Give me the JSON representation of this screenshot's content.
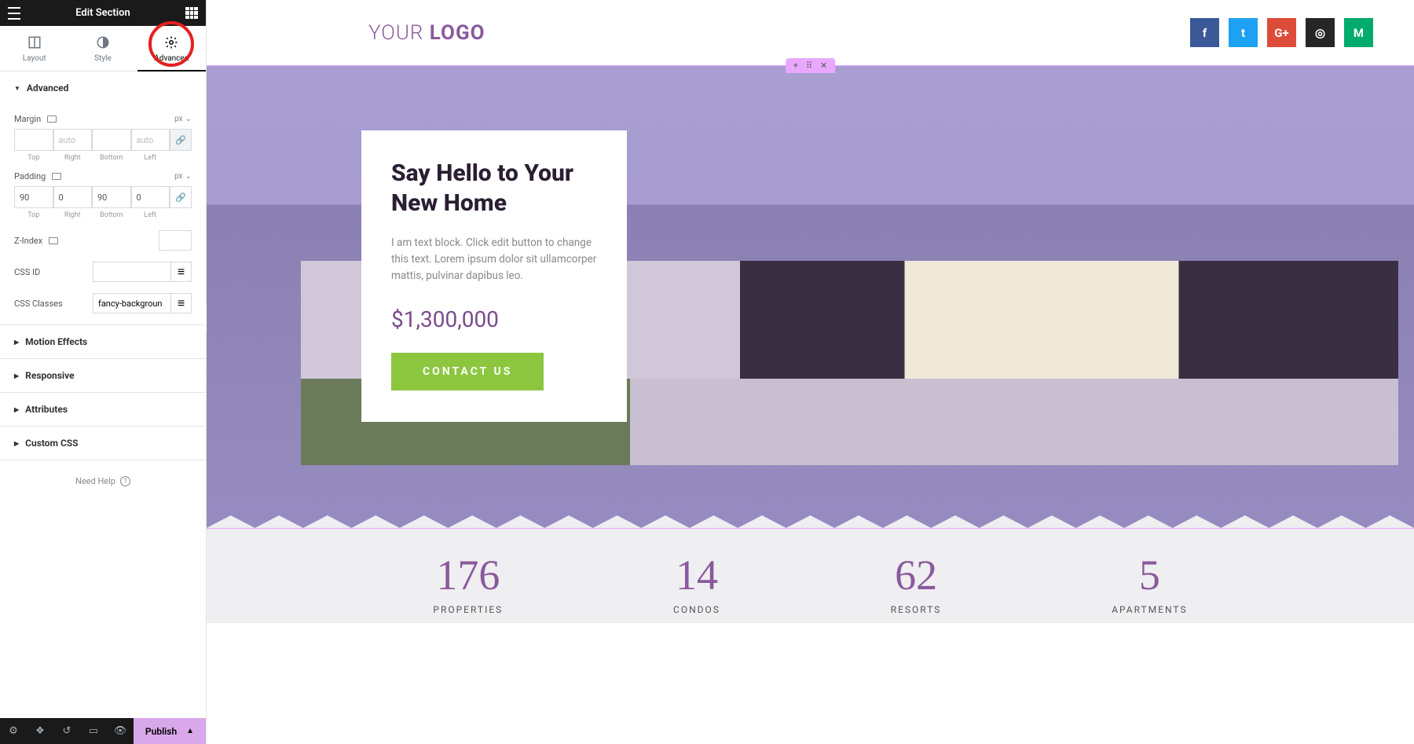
{
  "header": {
    "title": "Edit Section"
  },
  "tabs": [
    {
      "label": "Layout"
    },
    {
      "label": "Style"
    },
    {
      "label": "Advanced"
    }
  ],
  "panel": {
    "advanced_title": "Advanced",
    "margin": {
      "label": "Margin",
      "unit": "px",
      "top": "",
      "right": "",
      "bottom": "",
      "left": "",
      "ph_top": "",
      "ph_right": "auto",
      "ph_bottom": "",
      "ph_left": "auto",
      "lbl_top": "Top",
      "lbl_right": "Right",
      "lbl_bottom": "Bottom",
      "lbl_left": "Left"
    },
    "padding": {
      "label": "Padding",
      "unit": "px",
      "top": "90",
      "right": "0",
      "bottom": "90",
      "left": "0",
      "lbl_top": "Top",
      "lbl_right": "Right",
      "lbl_bottom": "Bottom",
      "lbl_left": "Left"
    },
    "zindex": {
      "label": "Z-Index",
      "value": ""
    },
    "cssid": {
      "label": "CSS ID",
      "value": ""
    },
    "cssclasses": {
      "label": "CSS Classes",
      "value": "fancy-backgroun"
    },
    "sections": {
      "motion": "Motion Effects",
      "responsive": "Responsive",
      "attributes": "Attributes",
      "customcss": "Custom CSS"
    },
    "help": "Need Help"
  },
  "publish": "Publish",
  "canvas": {
    "logo_a": "YOUR ",
    "logo_b": "LOGO",
    "socials": [
      {
        "name": "facebook",
        "bg": "#3b5998",
        "txt": "f"
      },
      {
        "name": "twitter",
        "bg": "#1da1f2",
        "txt": "t"
      },
      {
        "name": "google",
        "bg": "#dd4b39",
        "txt": "G+"
      },
      {
        "name": "instagram",
        "bg": "#262626",
        "txt": "◎"
      },
      {
        "name": "medium",
        "bg": "#00ab6c",
        "txt": "M"
      }
    ],
    "hero": {
      "title": "Say Hello to Your New Home",
      "text": "I am text block. Click edit button to change this text. Lorem ipsum dolor sit ullamcorper mattis, pulvinar dapibus leo.",
      "price": "$1,300,000",
      "button": "CONTACT US"
    },
    "stats": [
      {
        "num": "176",
        "lbl": "PROPERTIES"
      },
      {
        "num": "14",
        "lbl": "CONDOS"
      },
      {
        "num": "62",
        "lbl": "RESORTS"
      },
      {
        "num": "5",
        "lbl": "APARTMENTS"
      }
    ]
  }
}
